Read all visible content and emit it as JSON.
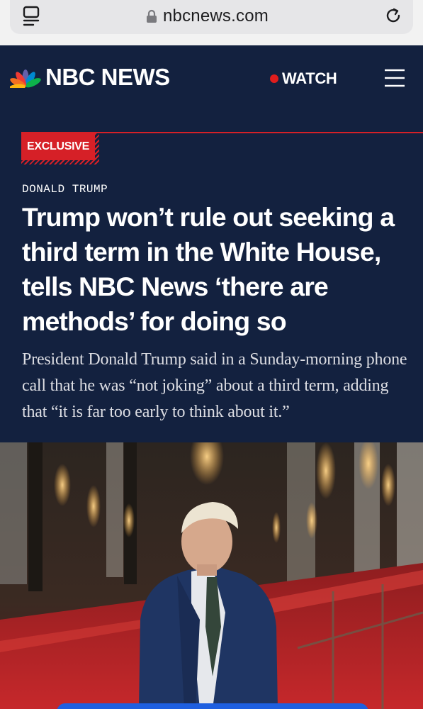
{
  "browser": {
    "url": "nbcnews.com",
    "icons": [
      "tabs-icon",
      "lock-icon",
      "reload-icon"
    ]
  },
  "header": {
    "brand": "NBC NEWS",
    "watch_label": "WATCH",
    "icons": [
      "peacock-logo",
      "live-dot",
      "menu-icon"
    ]
  },
  "article": {
    "badge": "EXCLUSIVE",
    "category": "DONALD TRUMP",
    "headline": "Trump won’t rule out seeking a third term in the White House, tells NBC News ‘there are methods’ for doing so",
    "dek": "President Donald Trump said in a Sunday-morning phone call that he was “not joking” about a third term, adding that “it is far too early to think about it.”"
  },
  "colors": {
    "navy": "#13213f",
    "accent_red": "#d62027",
    "live_red": "#e01d1d",
    "cta_blue": "#1e5fe0"
  }
}
